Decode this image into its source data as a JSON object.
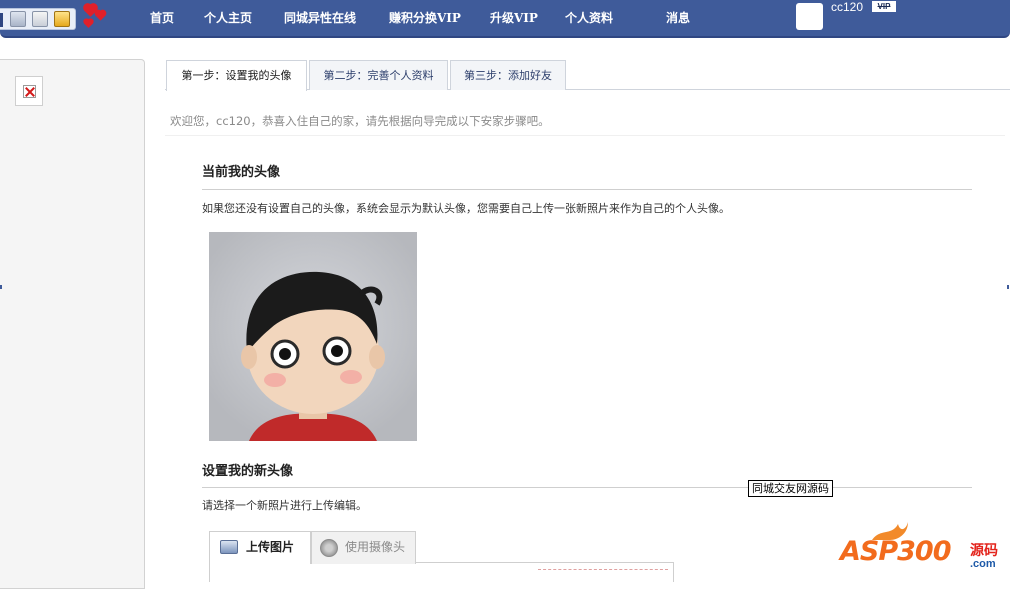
{
  "nav": {
    "links": [
      "首页",
      "个人主页",
      "同城异性在线",
      "赚积分换VIP",
      "升级VIP",
      "个人资料",
      "消息"
    ],
    "user": {
      "name": "cc120",
      "badge": "VIP"
    }
  },
  "tabs": [
    "第一步：设置我的头像",
    "第二步：完善个人资料",
    "第三步：添加好友"
  ],
  "active_tab_index": 0,
  "welcome": "欢迎您，cc120，恭喜入住自己的家，请先根据向导完成以下安家步骤吧。",
  "current_avatar": {
    "title": "当前我的头像",
    "desc": "如果您还没有设置自己的头像，系统会显示为默认头像，您需要自己上传一张新照片来作为自己的个人头像。"
  },
  "new_avatar": {
    "title": "设置我的新头像",
    "desc": "请选择一个新照片进行上传编辑。"
  },
  "tooltip": "同城交友网源码",
  "upload_tabs": [
    "上传图片",
    "使用摄像头"
  ],
  "watermark": {
    "brand": "ASP300",
    "cn": "源码",
    "suffix": ".com"
  },
  "colors": {
    "nav_bg": "#3f5b9a",
    "nav_text": "#ffffff",
    "tab_text": "#2c3e6b"
  },
  "icons": [
    "printer-icon",
    "mail-icon",
    "folder-icon",
    "hearts-icon",
    "broken-image-icon",
    "picture-icon",
    "camera-icon"
  ]
}
